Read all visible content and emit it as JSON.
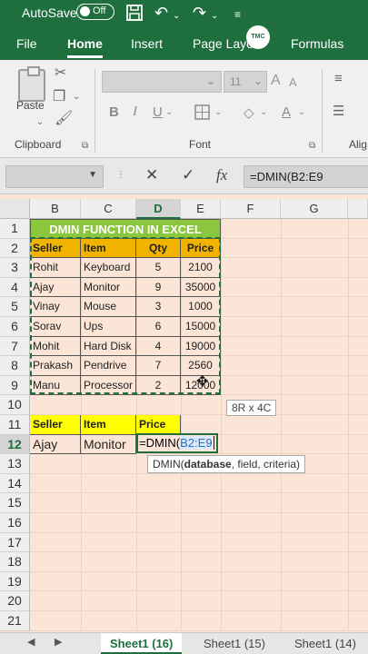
{
  "titlebar": {
    "autosave": "AutoSave",
    "toggle": "Off"
  },
  "logo": "TMC",
  "ribbon_tabs": [
    "File",
    "Home",
    "Insert",
    "Page Layo",
    "Formulas"
  ],
  "ribbon": {
    "paste": "Paste",
    "font_size": "11",
    "groups": {
      "clipboard": "Clipboard",
      "font": "Font",
      "alignment": "Alig"
    }
  },
  "formula_bar": {
    "formula": "=DMIN(B2:E9"
  },
  "columns": [
    "B",
    "C",
    "D",
    "E",
    "F",
    "G"
  ],
  "rows": [
    "1",
    "2",
    "3",
    "4",
    "5",
    "6",
    "7",
    "8",
    "9",
    "10",
    "11",
    "12",
    "13",
    "14",
    "15",
    "16",
    "17",
    "18",
    "19",
    "20",
    "21"
  ],
  "sheet_title": "DMIN FUNCTION IN EXCEL",
  "table": {
    "headers": [
      "Seller",
      "Item",
      "Qty",
      "Price"
    ],
    "rows": [
      [
        "Rohit",
        "Keyboard",
        "5",
        "2100"
      ],
      [
        "Ajay",
        "Monitor",
        "9",
        "35000"
      ],
      [
        "Vinay",
        "Mouse",
        "3",
        "1000"
      ],
      [
        "Sorav",
        "Ups",
        "6",
        "15000"
      ],
      [
        "Mohit",
        "Hard Disk",
        "4",
        "19000"
      ],
      [
        "Prakash",
        "Pendrive",
        "7",
        "2560"
      ],
      [
        "Manu",
        "Processor",
        "2",
        "12000"
      ]
    ]
  },
  "criteria": {
    "headers": [
      "Seller",
      "Item",
      "Price"
    ],
    "values": [
      "Ajay",
      "Monitor"
    ]
  },
  "active_cell": {
    "prefix": "=DMIN(",
    "ref": "B2:E9"
  },
  "selection_size": "8R x 4C",
  "fn_tooltip": {
    "name": "DMIN(",
    "arg1": "database",
    "rest": ", field, criteria)"
  },
  "sheet_tabs": [
    "Sheet1 (16)",
    "Sheet1 (15)",
    "Sheet1 (14)"
  ]
}
